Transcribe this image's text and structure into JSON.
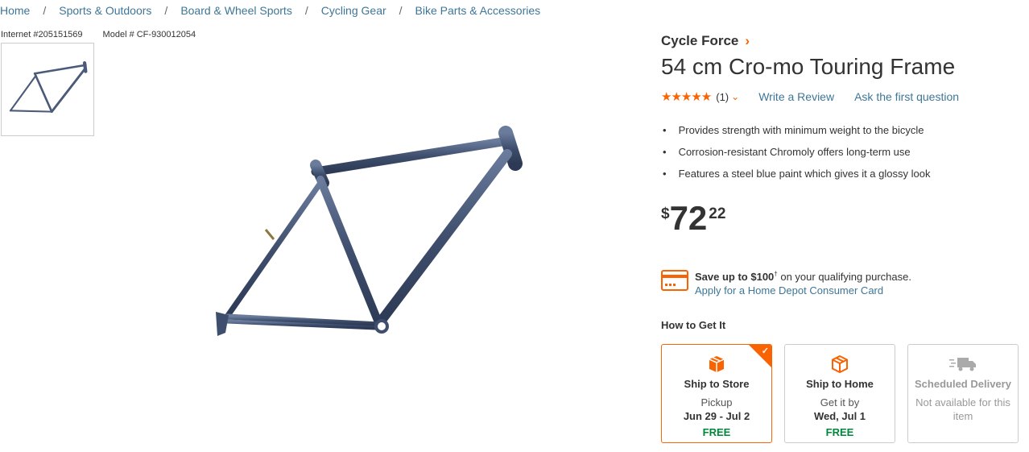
{
  "breadcrumb": [
    "Home",
    "Sports & Outdoors",
    "Board & Wheel Sports",
    "Cycling Gear",
    "Bike Parts & Accessories"
  ],
  "breadcrumb_separator": "/",
  "product": {
    "internet_id": "Internet #205151569",
    "model": "Model # CF-930012054",
    "brand": "Cycle Force",
    "title": "54 cm Cro-mo Touring Frame",
    "rating_count": "(1)",
    "rating_stars": 5,
    "write_review": "Write a Review",
    "ask_question": "Ask the first question",
    "bullets": [
      "Provides strength with minimum weight to the bicycle",
      "Corrosion-resistant Chromoly offers long-term use",
      "Features a steel blue paint which gives it a glossy look"
    ],
    "price": {
      "currency": "$",
      "dollars": "72",
      "cents": "22"
    },
    "promo": {
      "save_prefix": "Save up to ",
      "save_amount": "$100",
      "save_sup": "†",
      "save_suffix": " on your qualifying purchase.",
      "apply_link": "Apply for a Home Depot Consumer Card"
    },
    "how_to_get": "How to Get It",
    "fulfillment": [
      {
        "name": "Ship to Store",
        "sub": "Pickup",
        "date": "Jun 29 - Jul 2",
        "price": "FREE",
        "icon": "ship-to-store-icon"
      },
      {
        "name": "Ship to Home",
        "sub": "Get it by",
        "date": "Wed, Jul 1",
        "price": "FREE",
        "icon": "ship-to-home-icon"
      },
      {
        "name": "Scheduled Delivery",
        "sub": "Not available for this item",
        "icon": "scheduled-delivery-icon"
      }
    ]
  },
  "colors": {
    "accent": "#f96302",
    "link": "#3e7697",
    "free": "#00873c",
    "frame": "#4a5a78"
  }
}
